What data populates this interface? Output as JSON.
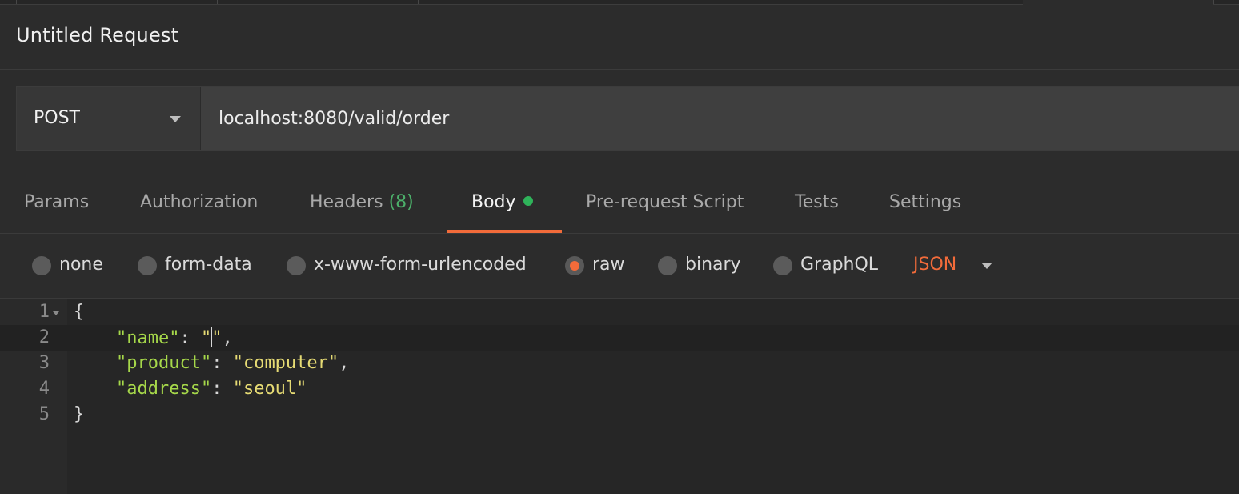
{
  "request": {
    "title": "Untitled Request",
    "method": "POST",
    "url": "localhost:8080/valid/order"
  },
  "tabs": [
    {
      "label": "Params"
    },
    {
      "label": "Authorization"
    },
    {
      "label": "Headers",
      "count": "(8)"
    },
    {
      "label": "Body",
      "active": true
    },
    {
      "label": "Pre-request Script"
    },
    {
      "label": "Tests"
    },
    {
      "label": "Settings"
    }
  ],
  "body_types": [
    {
      "label": "none",
      "selected": false
    },
    {
      "label": "form-data",
      "selected": false
    },
    {
      "label": "x-www-form-urlencoded",
      "selected": false
    },
    {
      "label": "raw",
      "selected": true
    },
    {
      "label": "binary",
      "selected": false
    },
    {
      "label": "GraphQL",
      "selected": false
    }
  ],
  "raw_format": "JSON",
  "editor": {
    "line_numbers": [
      "1",
      "2",
      "3",
      "4",
      "5"
    ],
    "open_brace": "{",
    "close_brace": "}",
    "lines": [
      {
        "key": "\"name\"",
        "value_before_cursor": "\"",
        "value_after_cursor": "\"",
        "trail": ","
      },
      {
        "key": "\"product\"",
        "value": "\"computer\"",
        "trail": ","
      },
      {
        "key": "\"address\"",
        "value": "\"seoul\"",
        "trail": ""
      }
    ]
  },
  "colors": {
    "accent": "#f26b3a",
    "success": "#2fb35a",
    "json_key": "#a6d84a",
    "json_string": "#e6db74"
  }
}
